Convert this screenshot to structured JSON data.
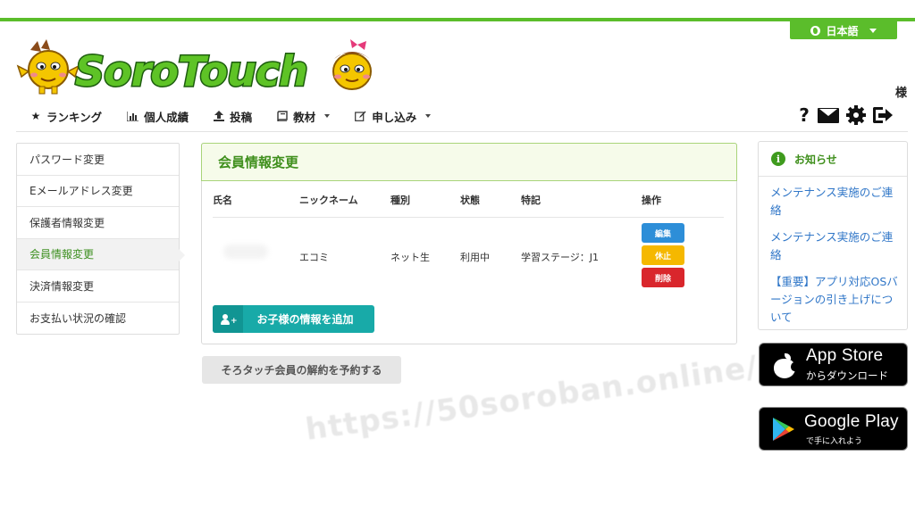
{
  "header": {
    "language_label": "日本語",
    "logo_text": "SoroTouch",
    "user_suffix": "様"
  },
  "nav": {
    "items": [
      {
        "label": "ランキング",
        "icon": "star-icon"
      },
      {
        "label": "個人成績",
        "icon": "bar-chart-icon"
      },
      {
        "label": "投稿",
        "icon": "upload-icon"
      },
      {
        "label": "教材",
        "icon": "book-icon",
        "dropdown": true
      },
      {
        "label": "申し込み",
        "icon": "edit-icon",
        "dropdown": true
      }
    ],
    "right_icons": [
      "help-icon",
      "mail-icon",
      "gear-icon",
      "sign-out-icon"
    ],
    "help_label": "?"
  },
  "sidebar": {
    "items": [
      {
        "label": "パスワード変更"
      },
      {
        "label": "Eメールアドレス変更"
      },
      {
        "label": "保護者情報変更"
      },
      {
        "label": "会員情報変更",
        "active": true
      },
      {
        "label": "決済情報変更"
      },
      {
        "label": "お支払い状況の確認"
      }
    ]
  },
  "main": {
    "title": "会員情報変更",
    "table": {
      "headers": [
        "氏名",
        "ニックネーム",
        "種別",
        "状態",
        "特記",
        "操作"
      ],
      "rows": [
        {
          "name": "",
          "nickname": "エコミ",
          "type": "ネット生",
          "status": "利用中",
          "note": "学習ステージ：J1"
        }
      ]
    },
    "actions": {
      "edit": "編集",
      "pause": "休止",
      "delete": "削除"
    },
    "add_child_label": "お子様の情報を追加",
    "cancel_label": "そろタッチ会員の解約を予約する"
  },
  "news": {
    "title": "お知らせ",
    "items": [
      "メンテナンス実施のご連絡",
      "メンテナンス実施のご連絡",
      "【重要】アプリ対応OSバージョンの引き上げについて"
    ]
  },
  "stores": {
    "apple": {
      "big": "App Store",
      "small": "からダウンロード"
    },
    "google": {
      "big": "Google Play",
      "small": "で手に入れよう"
    }
  },
  "watermark": "https://50soroban.online/",
  "colors": {
    "brand_green": "#5bbd2b",
    "edit_blue": "#2d8ed8",
    "pause_yellow": "#f5b800",
    "delete_red": "#d9262c",
    "add_teal": "#18aaa8",
    "link_blue": "#3177c8"
  }
}
